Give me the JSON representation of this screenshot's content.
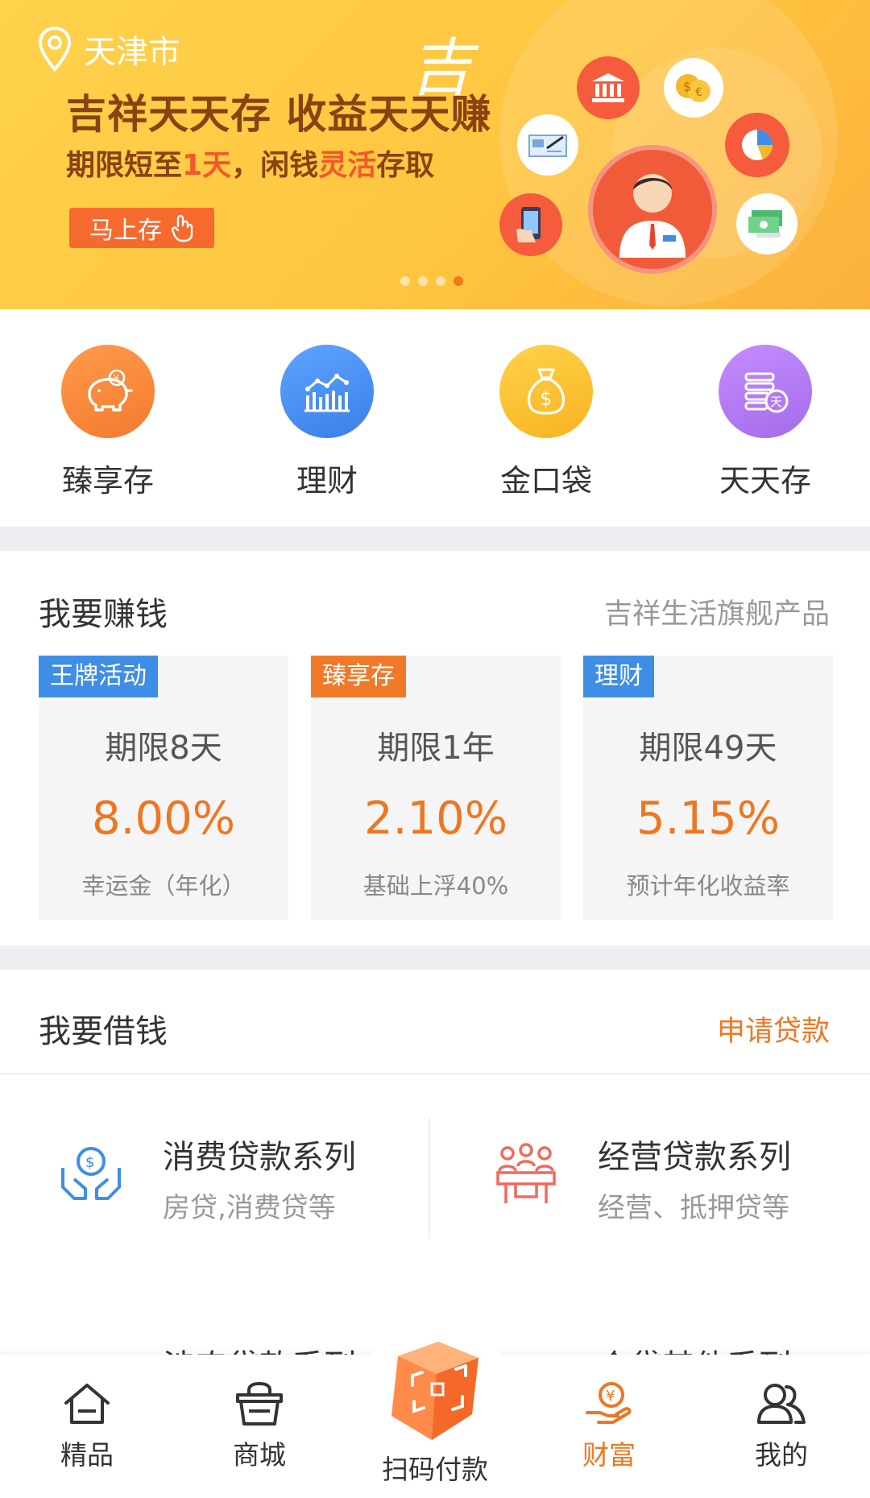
{
  "banner": {
    "city": "天津市",
    "logo": "吉",
    "title": "吉祥天天存 收益天天赚",
    "subtitle_pre": "期限短至",
    "subtitle_hl1": "1天",
    "subtitle_mid": "，闲钱",
    "subtitle_hl2": "灵活",
    "subtitle_post": "存取",
    "button_label": "马上存",
    "colors": {
      "bg": "#ffc640",
      "title": "#8a4212",
      "highlight": "#f6562a",
      "button": "#f66a2e"
    }
  },
  "quick_entries": [
    {
      "label": "臻享存",
      "icon": "piggy-bank-icon",
      "color": "#f7823a"
    },
    {
      "label": "理财",
      "icon": "bar-chart-icon",
      "color": "#4a8ff0"
    },
    {
      "label": "金口袋",
      "icon": "money-bag-icon",
      "color": "#f8bd2a"
    },
    {
      "label": "天天存",
      "icon": "coin-stack-icon",
      "color": "#b17bf0"
    }
  ],
  "earn": {
    "title": "我要赚钱",
    "subtitle": "吉祥生活旗舰产品",
    "cards": [
      {
        "tag": "王牌活动",
        "tag_color": "#3f8ee6",
        "term": "期限8天",
        "rate": "8.00%",
        "note": "幸运金（年化）"
      },
      {
        "tag": "臻享存",
        "tag_color": "#f07a2a",
        "term": "期限1年",
        "rate": "2.10%",
        "note": "基础上浮40%"
      },
      {
        "tag": "理财",
        "tag_color": "#3f8ee6",
        "term": "期限49天",
        "rate": "5.15%",
        "note": "预计年化收益率"
      }
    ]
  },
  "borrow": {
    "title": "我要借钱",
    "action": "申请贷款",
    "loans": [
      {
        "title": "消费贷款系列",
        "sub": "房贷,消费贷等",
        "icon": "hands-coin-icon"
      },
      {
        "title": "经营贷款系列",
        "sub": "经营、抵押贷等",
        "icon": "meeting-table-icon"
      },
      {
        "title": "涉农贷款系列",
        "sub": "",
        "icon": "sprout-icon"
      },
      {
        "title": "个贷其他系列",
        "sub": "",
        "icon": "clock-coin-icon"
      }
    ]
  },
  "tabbar": {
    "items": [
      {
        "label": "精品",
        "icon": "home-icon"
      },
      {
        "label": "商城",
        "icon": "basket-icon"
      },
      {
        "label": "扫码付款",
        "icon": "scan-cube-icon"
      },
      {
        "label": "财富",
        "icon": "wealth-hand-icon",
        "active": true
      },
      {
        "label": "我的",
        "icon": "users-icon"
      }
    ],
    "active_color": "#ef7620"
  }
}
